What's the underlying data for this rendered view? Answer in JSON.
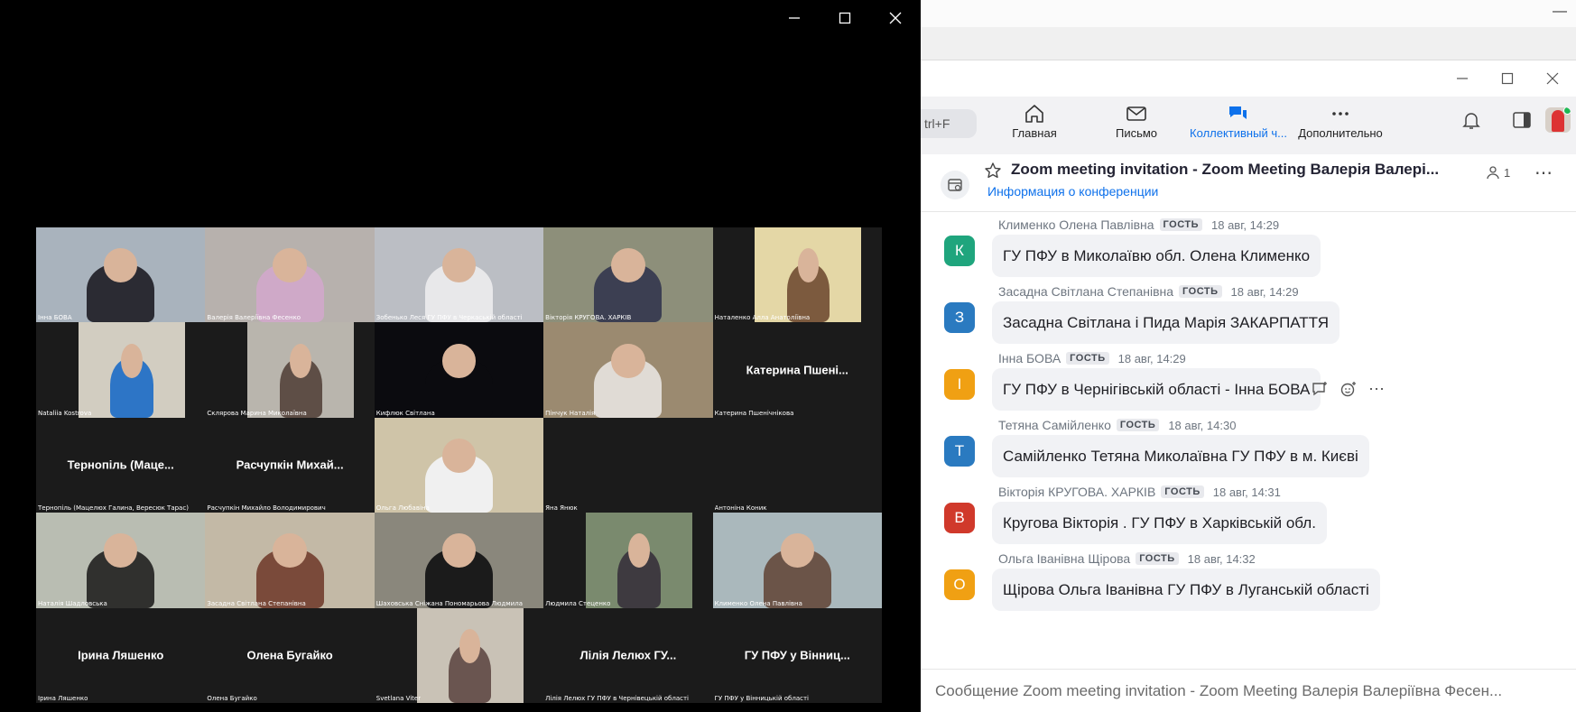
{
  "meeting": {
    "participants": [
      {
        "name": "Інна БОВА",
        "photo": {
          "bg": "#a9b3bd",
          "accent": "#2b2b33"
        }
      },
      {
        "name": "Валерія Валеріївна Фесенко",
        "photo": {
          "bg": "#b7b1ad",
          "accent": "#cfa9c8"
        }
      },
      {
        "name": "Зобенько Леся ГУ ПФУ в Черкаській області",
        "photo": {
          "bg": "#bbbec4",
          "accent": "#e8e8ea"
        }
      },
      {
        "name": "Вікторія КРУГОВА. ХАРКІВ",
        "photo": {
          "bg": "#8d8f7a",
          "accent": "#3c3f52"
        }
      },
      {
        "name": "Наталенко Алла Анатоліївна",
        "photo": {
          "bg": "#e4d7a6",
          "accent": "#7c5a3e"
        },
        "narrow": true
      },
      {
        "name": "Nataliia Kostrova",
        "photo": {
          "bg": "#d2cdc1",
          "accent": "#2d75c6"
        },
        "narrow": true
      },
      {
        "name": "Склярова Марина Миколаївна",
        "photo": {
          "bg": "#b9b5ad",
          "accent": "#5e4e46"
        },
        "narrow": true
      },
      {
        "name": "Кифлюк Світлана",
        "photo": {
          "bg": "#0b0b0f",
          "accent": "#0b0b0f"
        }
      },
      {
        "name": "Пінчук Наталія",
        "photo": {
          "bg": "#9b8a70",
          "accent": "#e0dbd5"
        }
      },
      {
        "name": "Катерина Пшенічнікова",
        "display": "Катерина  Пшені..."
      },
      {
        "name": "Тернопіль (Мацелюх Галина, Вересюк Тарас)",
        "display": "Тернопіль  (Маце..."
      },
      {
        "name": "Расчупкін Михайло Володимирович",
        "display": "Расчупкін  Михай..."
      },
      {
        "name": "Ольга Любавіна",
        "photo": {
          "bg": "#cfc4a8",
          "accent": "#f0f0f0"
        }
      },
      {
        "name": "Яна Янюк",
        "display": ""
      },
      {
        "name": "Антоніна Коник",
        "display": ""
      },
      {
        "name": "Наталія Шадловська",
        "photo": {
          "bg": "#b9bdb2",
          "accent": "#30302e"
        }
      },
      {
        "name": "Засадна Світлана Степанівна",
        "photo": {
          "bg": "#c3b9a6",
          "accent": "#7a4a3a"
        }
      },
      {
        "name": "Шаховська Сніжана Пономарьова Людмила",
        "photo": {
          "bg": "#8a877c",
          "accent": "#1b1b1b"
        }
      },
      {
        "name": "Людмила Стеценко",
        "photo": {
          "bg": "#7a8a6e",
          "accent": "#3e3a40"
        },
        "narrow": true
      },
      {
        "name": "Клименко Олена Павлівна",
        "photo": {
          "bg": "#aab8bc",
          "accent": "#6b5448"
        }
      },
      {
        "name": "Ірина Ляшенко",
        "display": "Ірина  Ляшенко"
      },
      {
        "name": "Олена Бугайко",
        "display": "Олена  Бугайко"
      },
      {
        "name": "Svetlana Viter",
        "photo": {
          "bg": "#c9c2b6",
          "accent": "#6a5550"
        },
        "narrow": true
      },
      {
        "name": "Лілія Лелюх ГУ ПФУ в Чернівецькій області",
        "display": "Лілія  Лелюх  ГУ..."
      },
      {
        "name": "ГУ ПФУ у Вінницькій області",
        "display": "ГУ  ПФУ  у  Вінниц..."
      }
    ]
  },
  "chat": {
    "search_stub": "trl+F",
    "nav": [
      {
        "label": "Главная",
        "icon": "home-icon"
      },
      {
        "label": "Письмо",
        "icon": "mail-icon"
      },
      {
        "label": "Коллективный ч...",
        "icon": "team-chat-icon",
        "active": true
      },
      {
        "label": "Дополнительно",
        "icon": "more-icon"
      }
    ],
    "channel": {
      "title": "Zoom meeting invitation - Zoom Meeting Валерія Валері...",
      "subtitle": "Информация о конференции",
      "members": "1"
    },
    "guest_label": "ГОСТЬ",
    "messages": [
      {
        "sender": "Клименко Олена Павлівна",
        "time": "18 авг, 14:29",
        "initial": "К",
        "color": "#1fa57d",
        "text": "ГУ ПФУ в Миколаївю обл.  Олена  Клименко"
      },
      {
        "sender": "Засадна Світлана Степанівна",
        "time": "18 авг, 14:29",
        "initial": "З",
        "color": "#2a7ac0",
        "text": "Засадна Світлана і Пида Марія ЗАКАРПАТТЯ"
      },
      {
        "sender": "Інна БОВА",
        "time": "18 авг, 14:29",
        "initial": "І",
        "color": "#f0a013",
        "text": "ГУ ПФУ в Чернігівській області - Інна БОВА",
        "hover": true
      },
      {
        "sender": "Тетяна Самійленко",
        "time": "18 авг, 14:30",
        "initial": "Т",
        "color": "#2a7ac0",
        "text": "Самійленко Тетяна Миколаївна ГУ ПФУ в м. Києві"
      },
      {
        "sender": "Вікторія КРУГОВА. ХАРКІВ",
        "time": "18 авг, 14:31",
        "initial": "В",
        "color": "#d0392b",
        "text": "Кругова Вікторія . ГУ ПФУ в Харківській обл."
      },
      {
        "sender": "Ольга Іванівна Щірова",
        "time": "18 авг, 14:32",
        "initial": "О",
        "color": "#f0a013",
        "text": "Щірова Ольга Іванівна ГУ ПФУ в Луганській області"
      }
    ],
    "composer_placeholder": "Сообщение Zoom meeting invitation - Zoom Meeting Валерія Валеріївна Фесен..."
  }
}
